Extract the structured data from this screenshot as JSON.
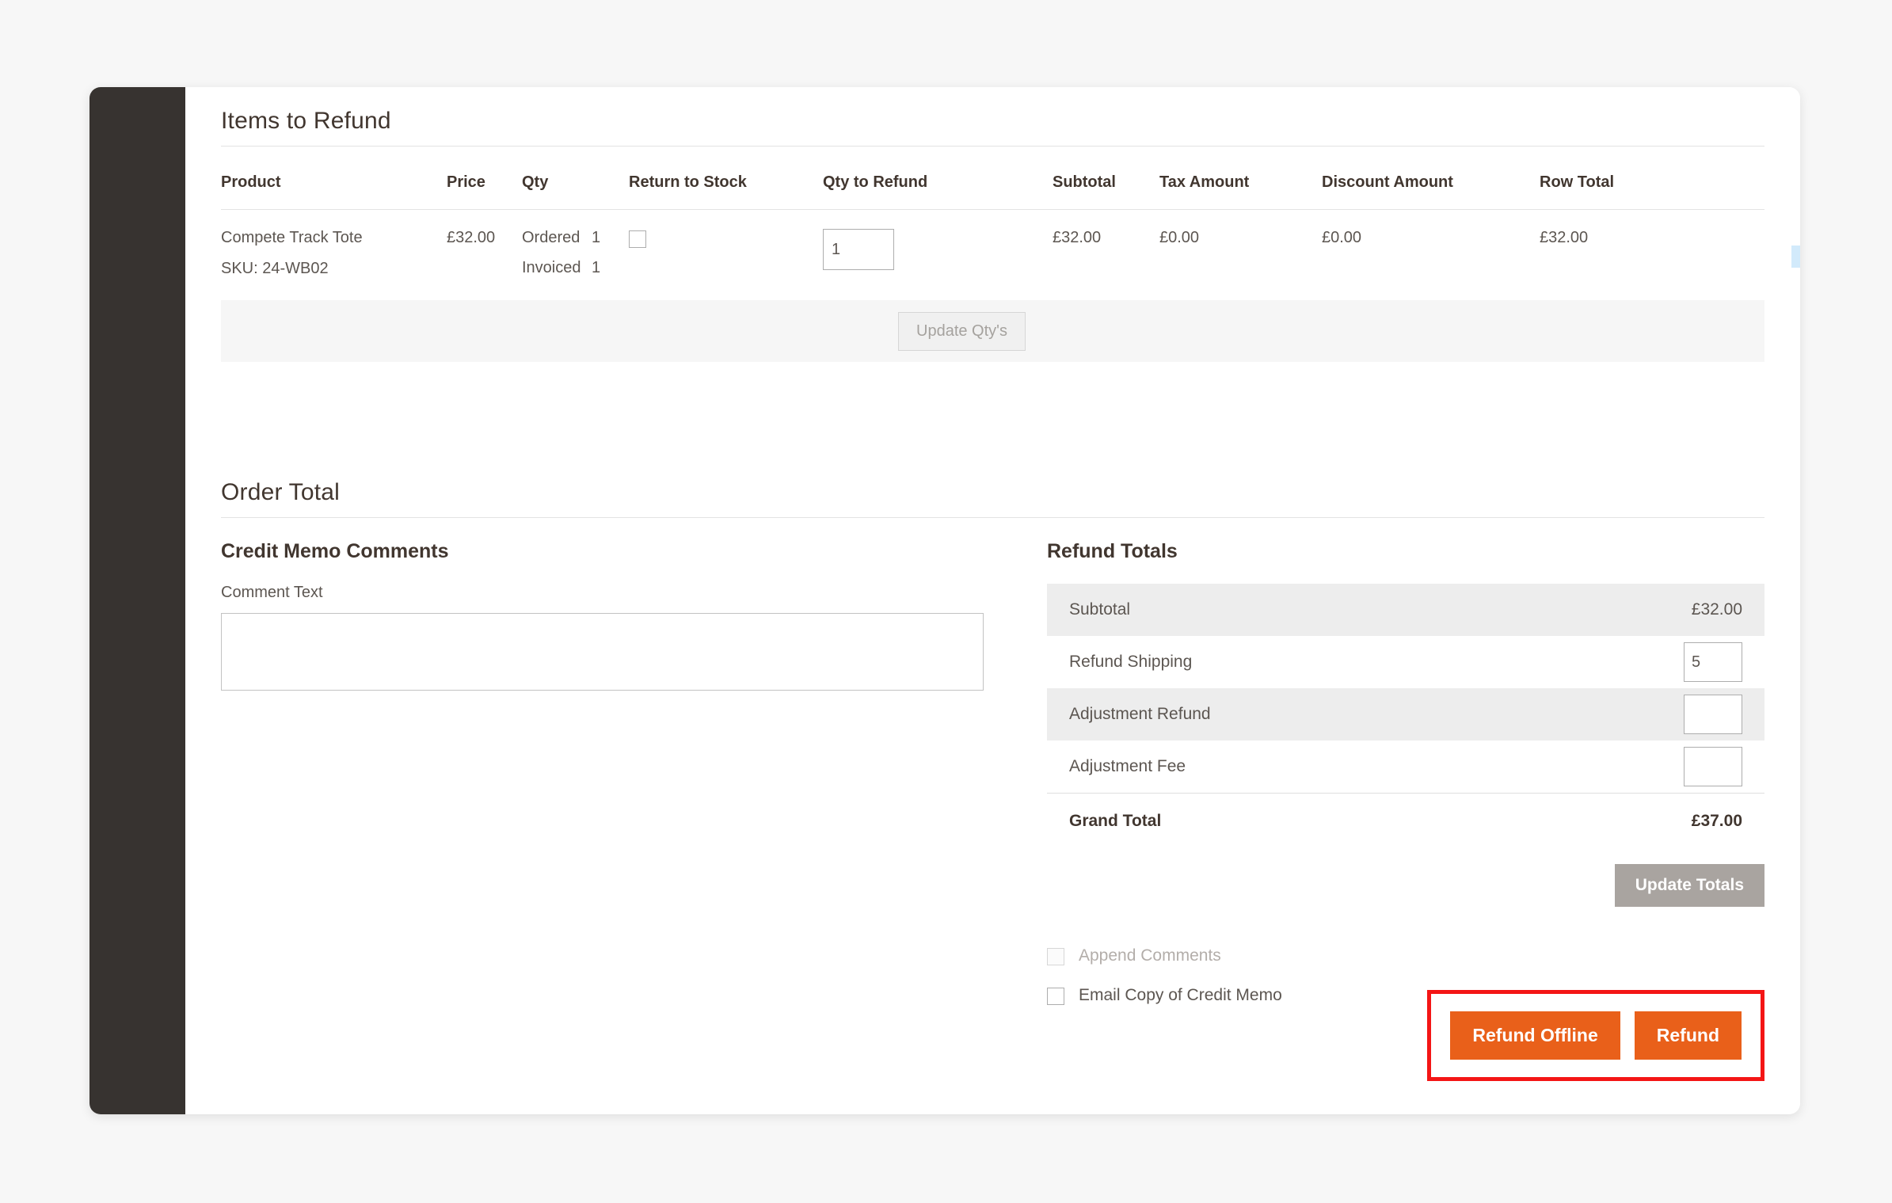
{
  "items_section": {
    "title": "Items to Refund",
    "columns": [
      "Product",
      "Price",
      "Qty",
      "Return to Stock",
      "Qty to Refund",
      "Subtotal",
      "Tax Amount",
      "Discount Amount",
      "Row Total"
    ],
    "rows": [
      {
        "product_name": "Compete Track Tote",
        "sku": "SKU: 24-WB02",
        "price": "£32.00",
        "qty_ordered_label": "Ordered",
        "qty_ordered_value": "1",
        "qty_invoiced_label": "Invoiced",
        "qty_invoiced_value": "1",
        "return_to_stock_checked": false,
        "qty_to_refund": "1",
        "subtotal": "£32.00",
        "tax_amount": "£0.00",
        "discount_amount": "£0.00",
        "row_total": "£32.00"
      }
    ],
    "update_qty_label": "Update Qty's"
  },
  "order_total": {
    "title": "Order Total"
  },
  "credit_memo_comments": {
    "heading": "Credit Memo Comments",
    "comment_label": "Comment Text",
    "comment_value": "",
    "comment_placeholder": ""
  },
  "refund_totals": {
    "heading": "Refund Totals",
    "rows": [
      {
        "label": "Subtotal",
        "value": "£32.00",
        "input": false
      },
      {
        "label": "Refund Shipping",
        "value": "5",
        "input": true
      },
      {
        "label": "Adjustment Refund",
        "value": "",
        "input": true
      },
      {
        "label": "Adjustment Fee",
        "value": "",
        "input": true
      }
    ],
    "grand_total_label": "Grand Total",
    "grand_total_value": "£37.00",
    "update_totals_label": "Update Totals",
    "append_comments_label": "Append Comments",
    "append_comments_checked": false,
    "append_comments_disabled": true,
    "email_copy_label": "Email Copy of Credit Memo",
    "email_copy_checked": false
  },
  "actions": {
    "refund_offline_label": "Refund Offline",
    "refund_label": "Refund"
  },
  "colors": {
    "accent_orange": "#e9601a",
    "highlight_red": "#f41515",
    "sidebar_dark": "#373330",
    "disabled_gray": "#a9a4a0",
    "row_stripe": "#ededed",
    "page_bg": "#f7f7f7"
  }
}
